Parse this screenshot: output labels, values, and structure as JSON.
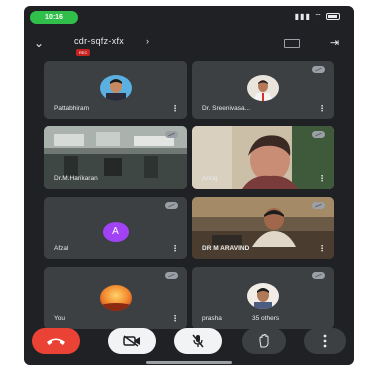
{
  "status_bar": {
    "time": "10:16"
  },
  "header": {
    "meeting_code": "cdr-sqfz-xfx",
    "meeting_arrow": "›",
    "rec_badge": "REC",
    "back_icon": "chevron-down-icon",
    "cast_icon": "cast-icon",
    "exit_icon": "exit-icon"
  },
  "participants": [
    {
      "name": "Pattabhiram",
      "tile": "avatar-photo"
    },
    {
      "name": "Dr. Sreenivasa...",
      "tile": "avatar-photo"
    },
    {
      "name": "Dr.M.Harikaran",
      "tile": "video"
    },
    {
      "name": "Anraj",
      "tile": "video"
    },
    {
      "name": "Afzal",
      "tile": "avatar-letter",
      "letter": "A"
    },
    {
      "name": "DR M ARAVIND",
      "tile": "video"
    },
    {
      "name": "You",
      "tile": "avatar-photo"
    },
    {
      "name": "prasha",
      "tile": "avatar-photo",
      "others": "35 others"
    }
  ],
  "controls": {
    "items": [
      "end-call-icon",
      "camera-off-icon",
      "mic-off-icon",
      "raise-hand-icon",
      "more-icon"
    ]
  },
  "colors": {
    "background": "#202124",
    "tile": "#3c4043",
    "end_call": "#ea4335",
    "call_pill": "#2fbf4a",
    "avatar_letter": "#a142f4"
  }
}
